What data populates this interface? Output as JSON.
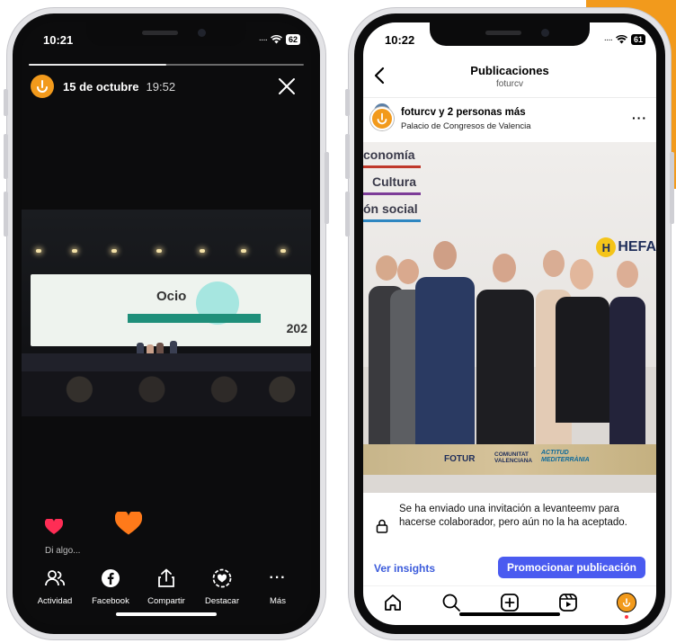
{
  "colors": {
    "accent": "#f29a1c",
    "instagram_blue": "#4a5bf0",
    "link_blue": "#3b5bdb",
    "heart_red": "#ff2d55",
    "heart_orange": "#ff7a1a"
  },
  "story": {
    "status_time": "10:21",
    "battery": "62",
    "progress": 0.5,
    "date": "15 de octubre",
    "time": "19:52",
    "screen_text_ocio": "Ocio",
    "screen_text_year": "202",
    "reply_hint": "Di algo...",
    "toolbar": [
      {
        "label": "Actividad",
        "icon": "people-icon"
      },
      {
        "label": "Facebook",
        "icon": "facebook-icon"
      },
      {
        "label": "Compartir",
        "icon": "share-icon"
      },
      {
        "label": "Destacar",
        "icon": "highlight-icon"
      },
      {
        "label": "Más",
        "icon": "more-icon"
      }
    ]
  },
  "post": {
    "status_time": "10:22",
    "battery": "61",
    "header_title": "Publicaciones",
    "header_sub": "foturcv",
    "user": "foturcv y 2 personas más",
    "location": "Palacio de Congresos de Valencia",
    "photo_words": [
      "conomía",
      "Cultura",
      "ón social"
    ],
    "photo_brand": "HEFA",
    "banner": {
      "fotur": "FOTUR",
      "cv": "COMUNITAT VALENCIANA",
      "act": "ACTITUD MEDITERRÀNIA"
    },
    "invite_text": "Se ha enviado una invitación a levanteemv para hacerse colaborador, pero aún no la ha aceptado.",
    "insights_label": "Ver insights",
    "promote_label": "Promocionar publicación",
    "tabs": [
      "home-icon",
      "search-icon",
      "create-icon",
      "reels-icon",
      "profile-icon"
    ]
  }
}
